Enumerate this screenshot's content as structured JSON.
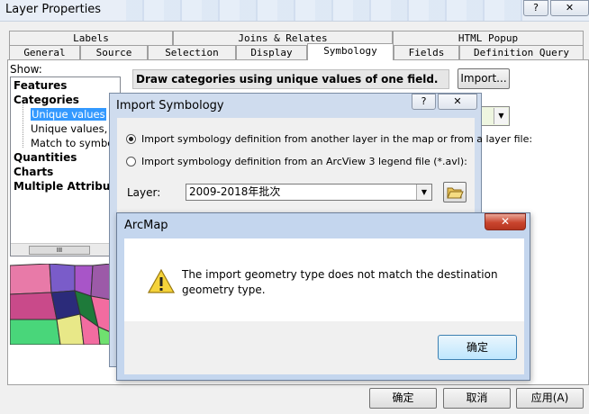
{
  "layer_properties": {
    "title": "Layer Properties",
    "help_label": "?",
    "close_label": "✕",
    "tabs_row1": [
      "Labels",
      "Joins & Relates",
      "HTML Popup"
    ],
    "tabs_row2": [
      "General",
      "Source",
      "Selection",
      "Display",
      "Symbology",
      "Fields",
      "Definition Query"
    ],
    "active_tab": "Symbology",
    "show_label": "Show:",
    "tree": [
      {
        "label": "Features",
        "level": 0,
        "bold": true
      },
      {
        "label": "Categories",
        "level": 0,
        "bold": true
      },
      {
        "label": "Unique values",
        "level": 1,
        "selected": true
      },
      {
        "label": "Unique values, ma",
        "level": 1
      },
      {
        "label": "Match to symbols i",
        "level": 1
      },
      {
        "label": "Quantities",
        "level": 0,
        "bold": true
      },
      {
        "label": "Charts",
        "level": 0,
        "bold": true
      },
      {
        "label": "Multiple Attributes",
        "level": 0,
        "bold": true
      }
    ],
    "scroll_thumb": "III",
    "description": "Draw categories using unique values of one field.",
    "import_button": "Import...",
    "dropdown_arrow": "▼",
    "ok_button": "确定",
    "cancel_button": "取消",
    "apply_button": "应用(A)"
  },
  "import_symbology": {
    "title": "Import Symbology",
    "help_label": "?",
    "close_label": "✕",
    "option_layer": "Import symbology definition from another layer in the map or from a layer file:",
    "option_avl": "Import symbology definition from an ArcView 3 legend file (*.avl):",
    "selected_option": "option_layer",
    "layer_label": "Layer:",
    "layer_value": "2009-2018年批次",
    "dropdown_arrow": "▼"
  },
  "arcmap_dialog": {
    "title": "ArcMap",
    "close_label": "✕",
    "message": "The import geometry type does not match the destination geometry type.",
    "ok_button": "确定"
  },
  "colors": {
    "selection": "#3399ff",
    "map_polygons": [
      "#e87aa8",
      "#7a5cc9",
      "#9c5aa8",
      "#f26ca0",
      "#49d67a",
      "#1e7a3a",
      "#c94a8a",
      "#6fe06f",
      "#e8e888",
      "#a855c8"
    ]
  }
}
